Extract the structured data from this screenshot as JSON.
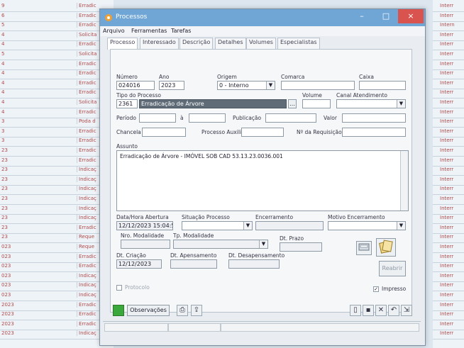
{
  "window": {
    "title": "Processos",
    "controls": {
      "minimize": "–",
      "maximize": "□",
      "close": "×"
    }
  },
  "menu": [
    "Arquivo",
    "Ferramentas",
    "Tarefas"
  ],
  "tabs": [
    "Processo",
    "Interessado",
    "Descrição",
    "Detalhes",
    "Volumes",
    "Especialistas"
  ],
  "form": {
    "numero": {
      "label": "Número",
      "value": "024016"
    },
    "ano": {
      "label": "Ano",
      "value": "2023"
    },
    "origem": {
      "label": "Origem",
      "value": "0 - Interno"
    },
    "comarca": {
      "label": "Comarca",
      "value": ""
    },
    "caixa": {
      "label": "Caixa",
      "value": ""
    },
    "tipo_processo": {
      "label": "Tipo do Processo",
      "code": "2361",
      "value": "Erradicação de Árvore"
    },
    "volume": {
      "label": "Volume",
      "value": ""
    },
    "canal_atendimento": {
      "label": "Canal Atendimento",
      "value": ""
    },
    "periodo": {
      "label": "Período",
      "from": "",
      "to": "",
      "sep": "à"
    },
    "publicacao": {
      "label": "Publicação",
      "value": ""
    },
    "valor": {
      "label": "Valor",
      "value": ""
    },
    "chancela": {
      "label": "Chancela",
      "value": ""
    },
    "processo_auxiliar": {
      "label": "Processo Auxiliar",
      "value": ""
    },
    "requisicao": {
      "label": "Nº da Requisição",
      "value": ""
    },
    "assunto": {
      "label": "Assunto",
      "value": "Erradicação de Árvore - IMÓVEL SOB CAD 53.13.23.0036.001"
    },
    "data_abertura": {
      "label": "Data/Hora Abertura",
      "value": "12/12/2023 15:04:58"
    },
    "situacao_processo": {
      "label": "Situação Processo",
      "value": ""
    },
    "encerramento": {
      "label": "Encerramento",
      "value": ""
    },
    "motivo_encerramento": {
      "label": "Motivo Encerramento",
      "value": ""
    },
    "nro_modalidade": {
      "label": "Nro. Modalidade",
      "value": ""
    },
    "tp_modalidade": {
      "label": "Tp. Modalidade",
      "value": ""
    },
    "dt_prazo": {
      "label": "Dt. Prazo",
      "value": ""
    },
    "dt_criacao": {
      "label": "Dt. Criação",
      "value": "12/12/2023"
    },
    "dt_apensamento": {
      "label": "Dt. Apensamento",
      "value": ""
    },
    "dt_desapensamento": {
      "label": "Dt. Desapensamento",
      "value": ""
    },
    "protocolo": {
      "label": "Protocolo",
      "checked": false
    },
    "impresso": {
      "label": "Impresso",
      "checked": true
    },
    "reabrir_button": "Reabrir"
  },
  "toolbar": {
    "observacoes": "Observações"
  },
  "background": {
    "left_rows": [
      [
        "9",
        "Erradic"
      ],
      [
        "6",
        "Erradic"
      ],
      [
        "5",
        "Erradic"
      ],
      [
        "4",
        "Solicita"
      ],
      [
        "4",
        "Erradic"
      ],
      [
        "5",
        "Solicita"
      ],
      [
        "4",
        "Erradic"
      ],
      [
        "4",
        "Erradic"
      ],
      [
        "4",
        "Erradic"
      ],
      [
        "4",
        "Erradic"
      ],
      [
        "4",
        "Solicita"
      ],
      [
        "4",
        "Erradic"
      ],
      [
        "3",
        "Poda d"
      ],
      [
        "3",
        "Erradic"
      ],
      [
        "3",
        "Erradic"
      ],
      [
        "23",
        "Erradic"
      ],
      [
        "23",
        "Erradic"
      ],
      [
        "23",
        "Indicaç"
      ],
      [
        "23",
        "Indicaç"
      ],
      [
        "23",
        "Indicaç"
      ],
      [
        "23",
        "Indicaç"
      ],
      [
        "23",
        "Indicaç"
      ],
      [
        "23",
        "Indicaç"
      ],
      [
        "23",
        "Erradic"
      ],
      [
        "23",
        "Reque"
      ],
      [
        "023",
        "Reque"
      ],
      [
        "023",
        "Erradic"
      ],
      [
        "023",
        "Erradic"
      ],
      [
        "023",
        "Indicaç"
      ],
      [
        "023",
        "Indicaç"
      ],
      [
        "023",
        "Indicaç"
      ],
      [
        "2023",
        "Erradic"
      ],
      [
        "2023",
        "Erradic"
      ],
      [
        "2023",
        "Erradic"
      ],
      [
        "2023",
        "Indicaç"
      ]
    ],
    "right_rows": [
      "Interr",
      "Interr",
      "Intern",
      "Interr",
      "Interr",
      "Interr",
      "Interr",
      "Interr",
      "Interr",
      "Interr",
      "Interr",
      "Interr",
      "Interr",
      "Interr",
      "Interr",
      "Interr",
      "Interr",
      "Interr",
      "Interr",
      "Interr",
      "Interr",
      "Interr",
      "Interr",
      "Interr",
      "Interr",
      "Interr",
      "Interr",
      "Interr",
      "Interr",
      "Interr",
      "Interr",
      "Interr",
      "Interr",
      "Interr",
      "Interr"
    ]
  }
}
